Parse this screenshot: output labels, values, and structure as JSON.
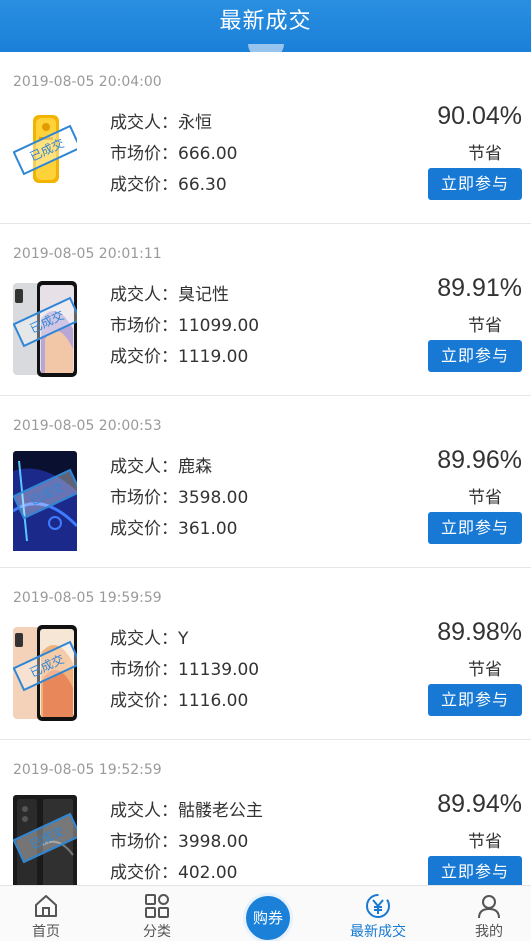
{
  "header": {
    "title": "最新成交"
  },
  "deals": [
    {
      "time": "2019-08-05 20:04:00",
      "buyer": "成交人：永恒",
      "market": "市场价：666.00",
      "deal": "成交价：66.30",
      "percent": "90.04%",
      "save_label": "节省",
      "button": "立即参与",
      "stamp": "已成交",
      "product": "gold-bar"
    },
    {
      "time": "2019-08-05 20:01:11",
      "buyer": "成交人：臭记性",
      "market": "市场价：11099.00",
      "deal": "成交价：1119.00",
      "percent": "89.91%",
      "save_label": "节省",
      "button": "立即参与",
      "stamp": "已成交",
      "product": "iphone-silver"
    },
    {
      "time": "2019-08-05 20:00:53",
      "buyer": "成交人：鹿森",
      "market": "市场价：3598.00",
      "deal": "成交价：361.00",
      "percent": "89.96%",
      "save_label": "节省",
      "button": "立即参与",
      "stamp": "已成交",
      "product": "vivo-phone"
    },
    {
      "time": "2019-08-05 19:59:59",
      "buyer": "成交人：Y",
      "market": "市场价：11139.00",
      "deal": "成交价：1116.00",
      "percent": "89.98%",
      "save_label": "节省",
      "button": "立即参与",
      "stamp": "已成交",
      "product": "iphone-gold"
    },
    {
      "time": "2019-08-05 19:52:59",
      "buyer": "成交人：骷髅老公主",
      "market": "市场价：3998.00",
      "deal": "成交价：402.00",
      "percent": "89.94%",
      "save_label": "节省",
      "button": "立即参与",
      "stamp": "已成交",
      "product": "black-phone"
    }
  ],
  "tabbar": {
    "home": "首页",
    "category": "分类",
    "coupon": "购券",
    "latest": "最新成交",
    "mine": "我的"
  },
  "colors": {
    "brand": "#1a80d8",
    "button": "#1779d3",
    "text": "#333333",
    "time": "#9a9a9a"
  },
  "icons": {
    "home": "home-icon",
    "category": "grid-icon",
    "latest": "yen-circle-icon",
    "mine": "user-icon"
  }
}
